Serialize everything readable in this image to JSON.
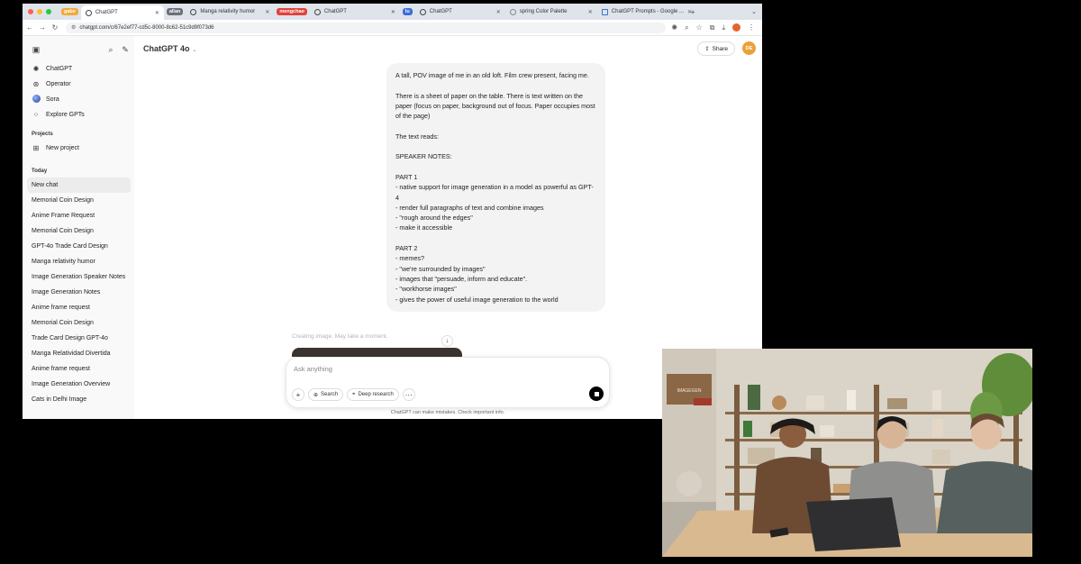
{
  "browser": {
    "tab_groups": [
      {
        "label": "gabe",
        "color": "#f2a93b"
      },
      {
        "label": "allan",
        "color": "#6b6f78"
      },
      {
        "label": "mengchao",
        "color": "#e0413a"
      },
      {
        "label": "lu",
        "color": "#3b6fd8"
      }
    ],
    "tabs": [
      {
        "label": "ChatGPT"
      },
      {
        "label": "Manga relativity humor"
      },
      {
        "label": "ChatGPT"
      },
      {
        "label": "ChatGPT"
      },
      {
        "label": "spring Color Palette"
      },
      {
        "label": "ChatGPT Prompts - Google ..."
      }
    ],
    "new_tab": "+",
    "url": "chatgpt.com/c/67e2ef77-cd5c-8000-8c62-51c9d9f073d6"
  },
  "sidebar": {
    "main_items": [
      {
        "label": "ChatGPT",
        "icon": "chatgpt-logo-icon"
      },
      {
        "label": "Operator",
        "icon": "operator-icon"
      },
      {
        "label": "Sora",
        "icon": "sora-icon"
      },
      {
        "label": "Explore GPTs",
        "icon": "grid-icon"
      }
    ],
    "projects_heading": "Projects",
    "new_project": "New project",
    "today_heading": "Today",
    "chats": [
      "New chat",
      "Memorial Coin Design",
      "Anime Frame Request",
      "Memorial Coin Design",
      "GPT-4o Trade Card Design",
      "Manga relativity humor",
      "Image Generation Speaker Notes",
      "Image Generation Notes",
      "Anime frame request",
      "Memorial Coin Design",
      "Trade Card Design GPT-4o",
      "Manga Relatividad Divertida",
      "Anime frame request",
      "Image Generation Overview",
      "Cats in Delhi Image"
    ]
  },
  "header": {
    "model": "ChatGPT 4o",
    "share": "Share",
    "user_initials": "DE"
  },
  "message": {
    "text": "A tall, POV image of me in an old loft. Film crew present, facing me.\n\nThere is a sheet of paper on the table. There is text written on the paper (focus on paper, background out of focus. Paper occupies most of the page)\n\nThe text reads:\n\nSPEAKER NOTES:\n\nPART 1\n- native support for image generation in a model as powerful as GPT-4\n- render full paragraphs of text and combine images\n- \"rough around the edges\"\n- make it accessible\n\nPART 2\n- memes?\n- \"we're surrounded by images\"\n- images that \"persuade, inform and educate\".\n- \"workhorse images\"\n- gives the power of useful image generation to the world"
  },
  "status": {
    "generating": "Creating image. May take a moment."
  },
  "composer": {
    "placeholder": "Ask anything",
    "search": "Search",
    "deep_research": "Deep research"
  },
  "disclaimer": "ChatGPT can make mistakes. Check important info.",
  "video": {
    "shelf_sign": "IMAGEGEN"
  },
  "colors": {
    "accent": "#10a37f",
    "sidebar_bg": "#f9f9f9",
    "bubble_bg": "#f3f3f3"
  }
}
